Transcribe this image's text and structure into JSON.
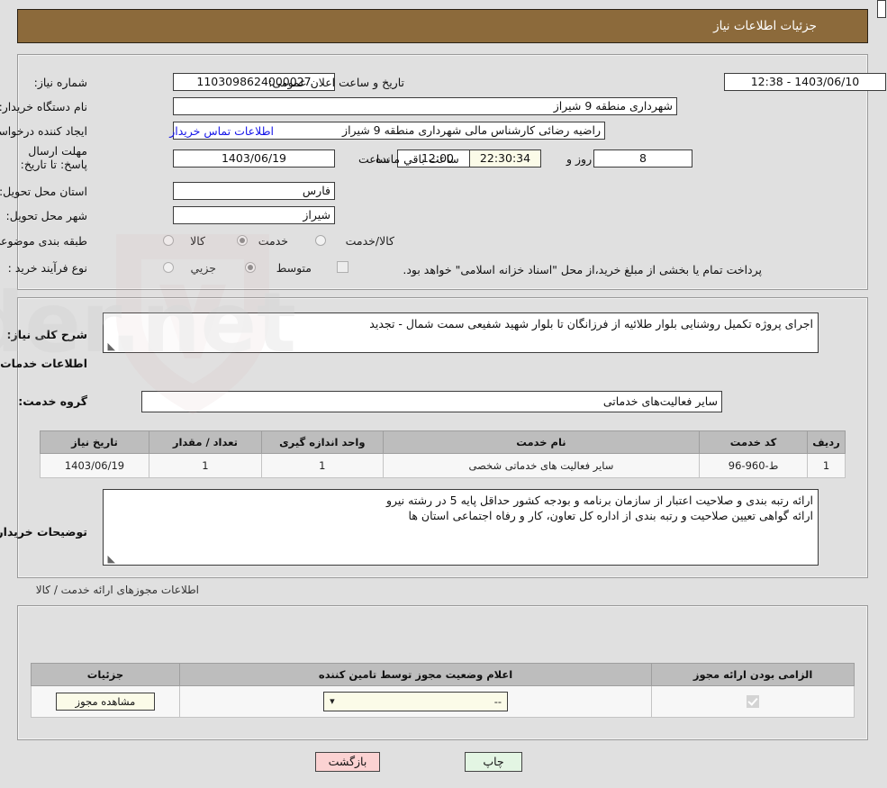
{
  "header": {
    "title": "جزئیات اطلاعات نیاز"
  },
  "form": {
    "need_number_label": "شماره نیاز:",
    "need_number_value": "1103098624000027",
    "announce_datetime_label": "تاریخ و ساعت اعلان عمومی:",
    "announce_datetime_value": "1403/06/10 - 12:38",
    "buyer_org_label": "نام دستگاه خریدار:",
    "buyer_org_value": "شهرداری منطقه 9 شیراز",
    "requester_label": "ایجاد کننده درخواست:",
    "requester_value": "راضیه رضائی کارشناس مالی شهرداری منطقه 9 شیراز",
    "buyer_contact_link": "اطلاعات تماس خریدار",
    "deadline_label": "مهلت ارسال پاسخ: تا تاریخ:",
    "deadline_date": "1403/06/19",
    "deadline_hour_label": "ساعت",
    "deadline_hour": "12:00",
    "remaining_days": "8",
    "remaining_days_label": "روز و",
    "remaining_time": "22:30:34",
    "remaining_suffix_label": "ساعت باقي مانده",
    "province_label": "استان محل تحویل:",
    "province_value": "فارس",
    "city_label": "شهر محل تحویل:",
    "city_value": "شیراز",
    "category_label": "طبقه بندی موضوعی:",
    "category_options": [
      "کالا",
      "خدمت",
      "کالا/خدمت"
    ],
    "category_selected": "خدمت",
    "process_label": "نوع فرآیند خرید :",
    "process_options": [
      "جزیي",
      "متوسط"
    ],
    "process_selected": "متوسط",
    "payment_note": "پرداخت تمام یا بخشی از مبلغ خرید،از محل \"اسناد خزانه اسلامی\" خواهد بود.",
    "payment_checked": false
  },
  "description": {
    "label": "شرح کلی نیاز:",
    "value": "اجرای پروژه تکمیل روشنایی بلوار طلائیه از فرزانگان تا بلوار شهید شفیعی سمت شمال - تجدید"
  },
  "services": {
    "section_title": "اطلاعات خدمات مورد نیاز",
    "group_label": "گروه خدمت:",
    "group_value": "سایر فعالیت‌های خدماتی",
    "table": {
      "headers": [
        "ردیف",
        "کد خدمت",
        "نام خدمت",
        "واحد اندازه گیری",
        "تعداد / مقدار",
        "تاریخ نیاز"
      ],
      "rows": [
        [
          "1",
          "ط-960-96",
          "سایر فعالیت های خدماتی شخصی",
          "1",
          "1",
          "1403/06/19"
        ]
      ]
    }
  },
  "buyer_notes": {
    "label": "توضیحات خریدار:",
    "lines": [
      "ارائه رتبه بندی و صلاحیت اعتبار از سازمان برنامه و بودجه کشور حداقل پایه 5 در رشته نیرو",
      "ارائه گواهی تعیین صلاحیت و رتبه بندی از اداره کل تعاون، کار و رفاه اجتماعی استان ها"
    ]
  },
  "permits": {
    "section_title": "اطلاعات مجوزهای ارائه خدمت / کالا",
    "headers": [
      "الزامی بودن ارائه مجوز",
      "اعلام وضعیت مجوز توسط تامین کننده",
      "جزئیات"
    ],
    "rows": [
      {
        "required": true,
        "status_value": "--",
        "detail_button": "مشاهده مجوز"
      }
    ]
  },
  "footer": {
    "back_button": "بازگشت",
    "print_button": "چاپ"
  },
  "watermark": {
    "text": "AriaTender.net"
  },
  "colors": {
    "header_bg": "#8c6a3b",
    "page_bg": "#e0e0e0",
    "link": "#1515e8",
    "back_btn": "#fbd2d2",
    "print_btn": "#e3f5e3",
    "cream_field": "#fbfbe8"
  }
}
